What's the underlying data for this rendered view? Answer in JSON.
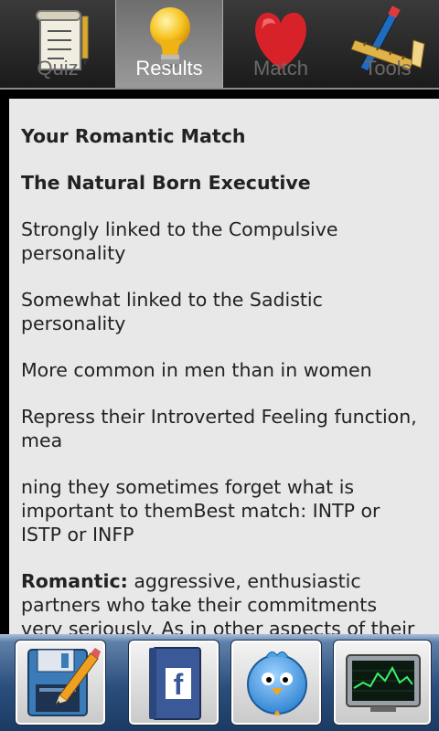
{
  "tabs": [
    {
      "label": "Quiz",
      "icon": "quiz-scroll-icon",
      "active": false
    },
    {
      "label": "Results",
      "icon": "lightbulb-icon",
      "active": true
    },
    {
      "label": "Match",
      "icon": "heart-icon",
      "active": false
    },
    {
      "label": "Tools",
      "icon": "tools-icon",
      "active": false
    }
  ],
  "content": {
    "heading": "Your Romantic Match",
    "type_name": "The Natural Born Executive",
    "line1": "Strongly linked to the Compulsive personality",
    "line2": "Somewhat linked to the Sadistic personality",
    "line3": "More common in men than in women",
    "line4": "Repress their Introverted Feeling function, mea",
    "line5": "ning they sometimes forget what is important to themBest match: INTP or ISTP or INFP",
    "romantic_label": "Romantic:",
    "romantic_text": " aggressive, enthusiastic partners who take their commitments very seriously. As in other aspects of their life, they want to be the leader in the relationship, and take on responsibility for making things work. The are"
  },
  "dock": {
    "buttons": [
      {
        "icon": "edit-save-icon"
      },
      {
        "icon": "facebook-book-icon"
      },
      {
        "icon": "twitter-bird-icon"
      },
      {
        "icon": "monitor-chart-icon"
      }
    ]
  },
  "colors": {
    "content_bg": "#e8e8e8",
    "text": "#222222",
    "dock_blue": "#2a4f7d",
    "heart_red": "#d8222a",
    "facebook_blue": "#3b5998",
    "twitter_blue": "#4aa3e8"
  }
}
